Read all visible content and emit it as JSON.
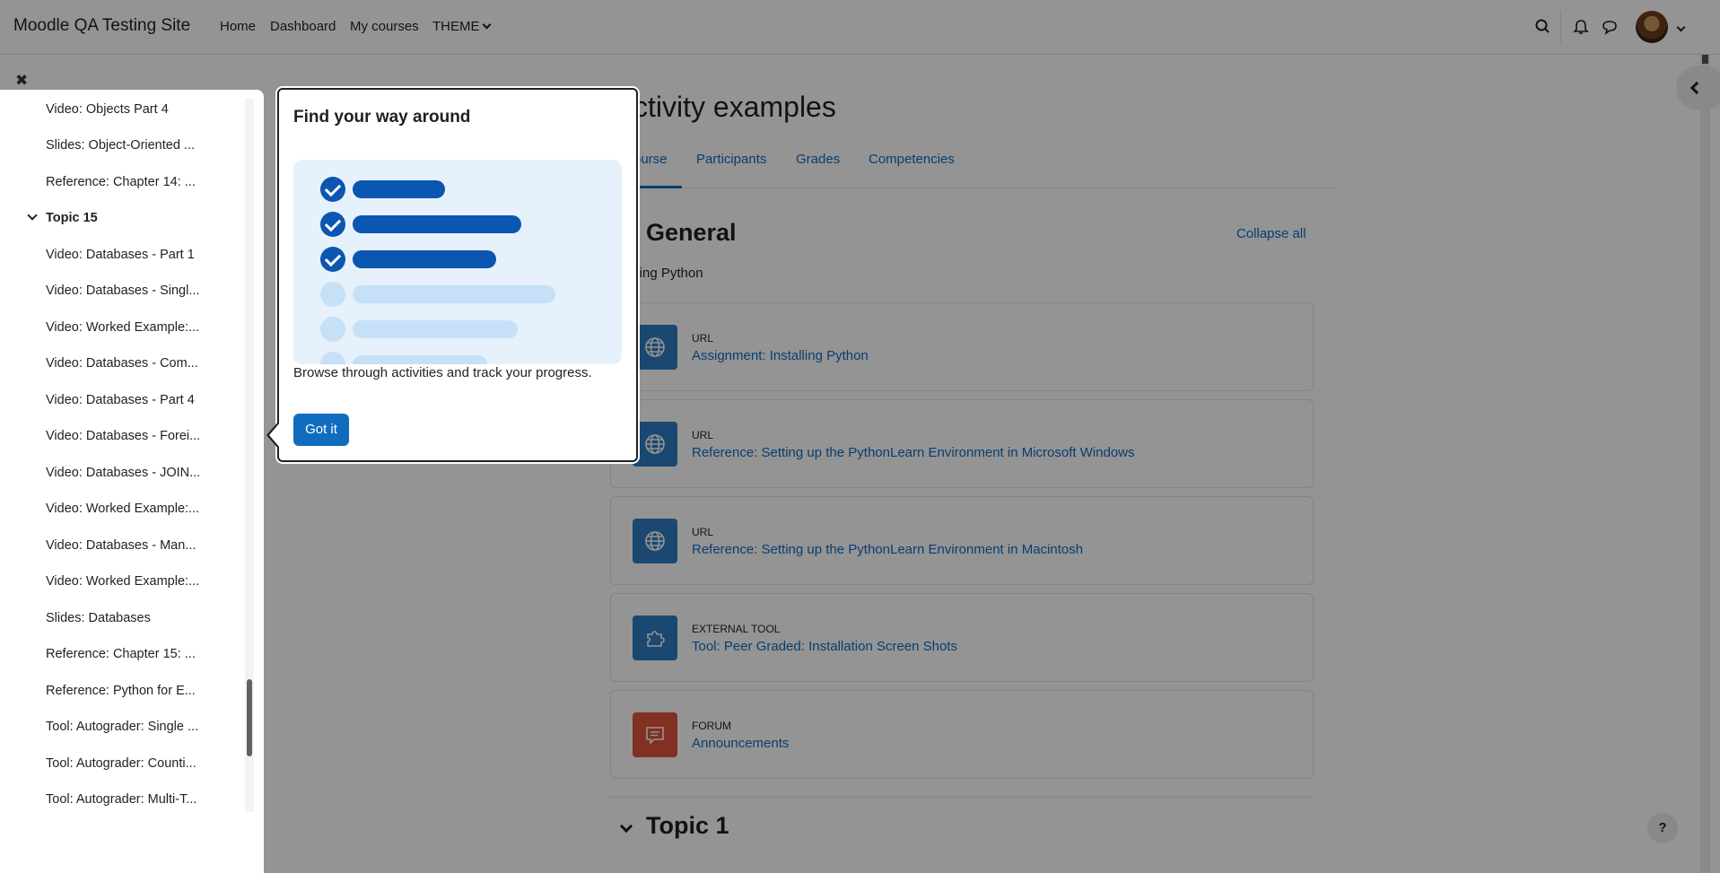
{
  "navbar": {
    "brand": "Moodle QA Testing Site",
    "links": [
      "Home",
      "Dashboard",
      "My courses",
      "THEME"
    ]
  },
  "course": {
    "title": "ctivity examples",
    "tabs": [
      "ourse",
      "Participants",
      "Grades",
      "Competencies"
    ],
    "section_title": "General",
    "collapse_all": "Collapse all",
    "section_summary": "lling Python",
    "activities": [
      {
        "type": "URL",
        "name": "Assignment: Installing Python",
        "icon": "globe-icon",
        "color": "#2f7dc1"
      },
      {
        "type": "URL",
        "name": "Reference: Setting up the PythonLearn Environment in Microsoft Windows",
        "icon": "globe-icon",
        "color": "#2f7dc1"
      },
      {
        "type": "URL",
        "name": "Reference: Setting up the PythonLearn Environment in Macintosh",
        "icon": "globe-icon",
        "color": "#2f7dc1"
      },
      {
        "type": "EXTERNAL TOOL",
        "name": "Tool: Peer Graded: Installation Screen Shots",
        "icon": "puzzle-icon",
        "color": "#2f7dc1"
      },
      {
        "type": "FORUM",
        "name": "Announcements",
        "icon": "forum-icon",
        "color": "#e0533a"
      }
    ],
    "next_section": "Topic 1"
  },
  "course_index": {
    "items_before": [
      "Video: Objects Part 4",
      "Slides: Object-Oriented ...",
      "Reference: Chapter 14: ..."
    ],
    "section": "Topic 15",
    "items": [
      "Video: Databases - Part 1",
      "Video: Databases - Singl...",
      "Video: Worked Example:...",
      "Video: Databases - Com...",
      "Video: Databases - Part 4",
      "Video: Databases - Forei...",
      "Video: Databases - JOIN...",
      "Video: Worked Example:...",
      "Video: Databases - Man...",
      "Video: Worked Example:...",
      "Slides: Databases",
      "Reference: Chapter 15: ...",
      "Reference: Python for E...",
      "Tool: Autograder: Single ...",
      "Tool: Autograder: Counti...",
      "Tool: Autograder: Multi-T..."
    ]
  },
  "tour": {
    "title": "Find your way around",
    "body": "Browse through activities and track your progress.",
    "button": "Got it"
  },
  "help": "?"
}
